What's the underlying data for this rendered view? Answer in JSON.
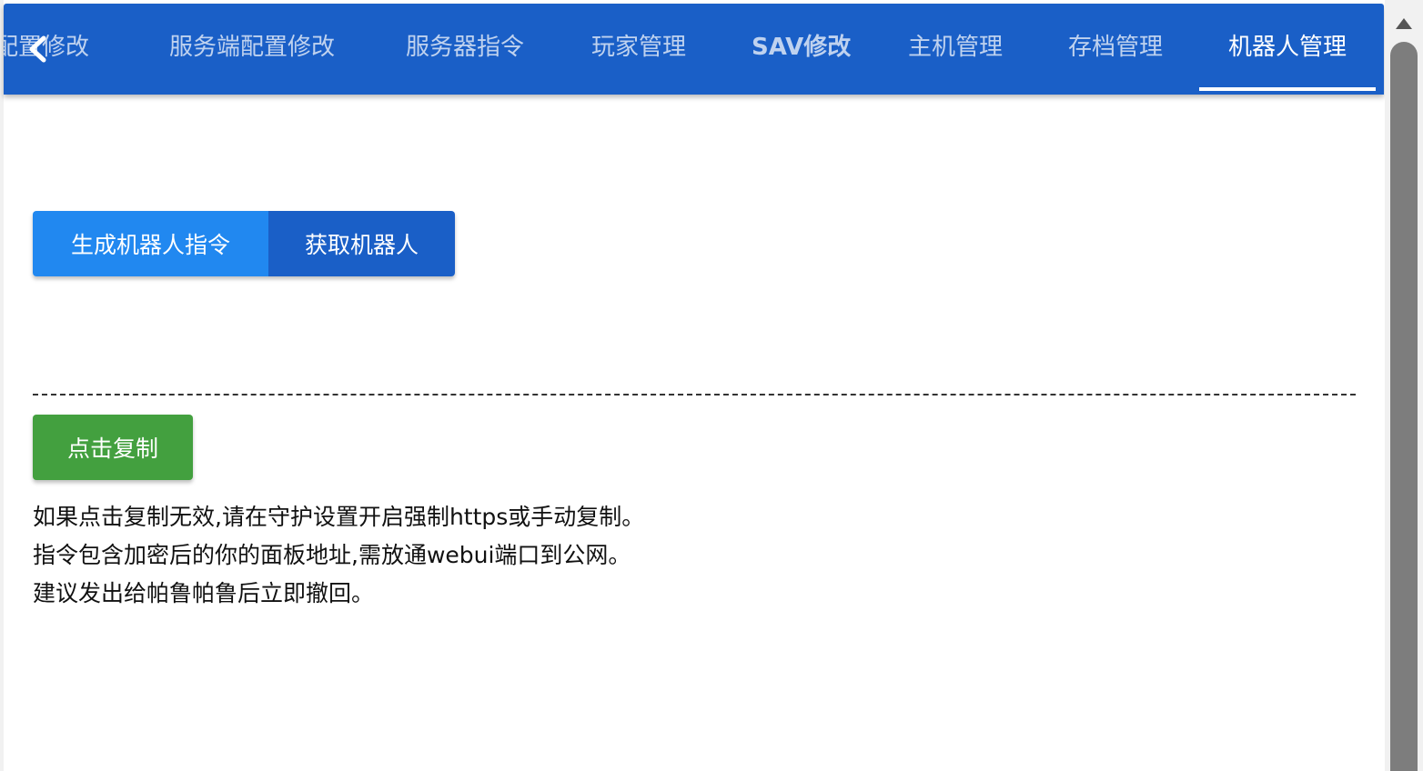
{
  "tabs": [
    {
      "label": "配置修改",
      "active": false,
      "partial": true
    },
    {
      "label": "服务端配置修改",
      "active": false
    },
    {
      "label": "服务器指令",
      "active": false
    },
    {
      "label": "玩家管理",
      "active": false
    },
    {
      "label": "SAV修改",
      "active": false
    },
    {
      "label": "主机管理",
      "active": false
    },
    {
      "label": "存档管理",
      "active": false
    },
    {
      "label": "机器人管理",
      "active": true
    }
  ],
  "icons": {
    "prev": "chevron-left-icon"
  },
  "colors": {
    "tabbar": "#1a5fc7",
    "generate_button": "#2188f0",
    "fetch_button": "#1a5fc7",
    "copy_button": "#43a03f"
  },
  "actions": {
    "generate_label": "生成机器人指令",
    "fetch_label": "获取机器人",
    "copy_label": "点击复制"
  },
  "notes": {
    "line1": "如果点击复制无效,请在守护设置开启强制https或手动复制。",
    "line2": "指令包含加密后的你的面板地址,需放通webui端口到公网。",
    "line3": "建议发出给帕鲁帕鲁后立即撤回。"
  }
}
